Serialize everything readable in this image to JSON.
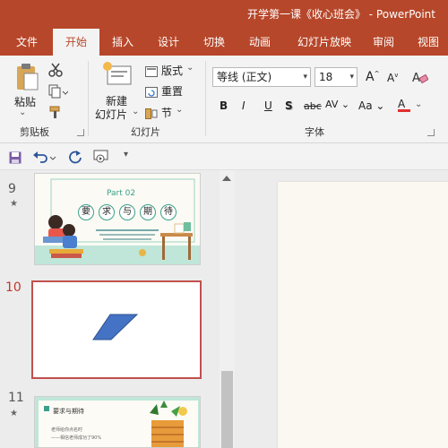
{
  "window": {
    "title": "开学第一课《收心班会》 - PowerPoint"
  },
  "tabs": [
    {
      "label": "文件"
    },
    {
      "label": "开始",
      "active": true
    },
    {
      "label": "插入"
    },
    {
      "label": "设计"
    },
    {
      "label": "切换"
    },
    {
      "label": "动画"
    },
    {
      "label": "幻灯片放映"
    },
    {
      "label": "审阅"
    },
    {
      "label": "视图"
    }
  ],
  "ribbon": {
    "clipboard": {
      "label": "剪贴板",
      "paste": "粘贴"
    },
    "slides": {
      "label": "幻灯片",
      "new_slide_line1": "新建",
      "new_slide_line2": "幻灯片",
      "layout": "版式",
      "reset": "重置",
      "section": "节"
    },
    "font": {
      "label": "字体",
      "font_name": "等线 (正文)",
      "font_size": "18",
      "grow": "A",
      "shrink": "A",
      "bold": "B",
      "italic": "I",
      "underline": "U",
      "shadow": "S",
      "strike": "abc",
      "spacing": "AV",
      "case": "Aa",
      "color": "A"
    }
  },
  "colors": {
    "accent": "#b7472a",
    "selected_slide_border": "#c0504d",
    "shape_fill": "#4472c4",
    "font_color_bar": "#e0302f"
  },
  "slides": [
    {
      "number": "9",
      "star": "★",
      "part": "Part 02",
      "chars": [
        "要",
        "求",
        "与",
        "期",
        "待"
      ]
    },
    {
      "number": "10",
      "selected": true
    },
    {
      "number": "11",
      "star": "★",
      "heading": "要求与期待",
      "lines": [
        "老师给你点名时",
        "——相信老师成功了90%"
      ]
    }
  ]
}
